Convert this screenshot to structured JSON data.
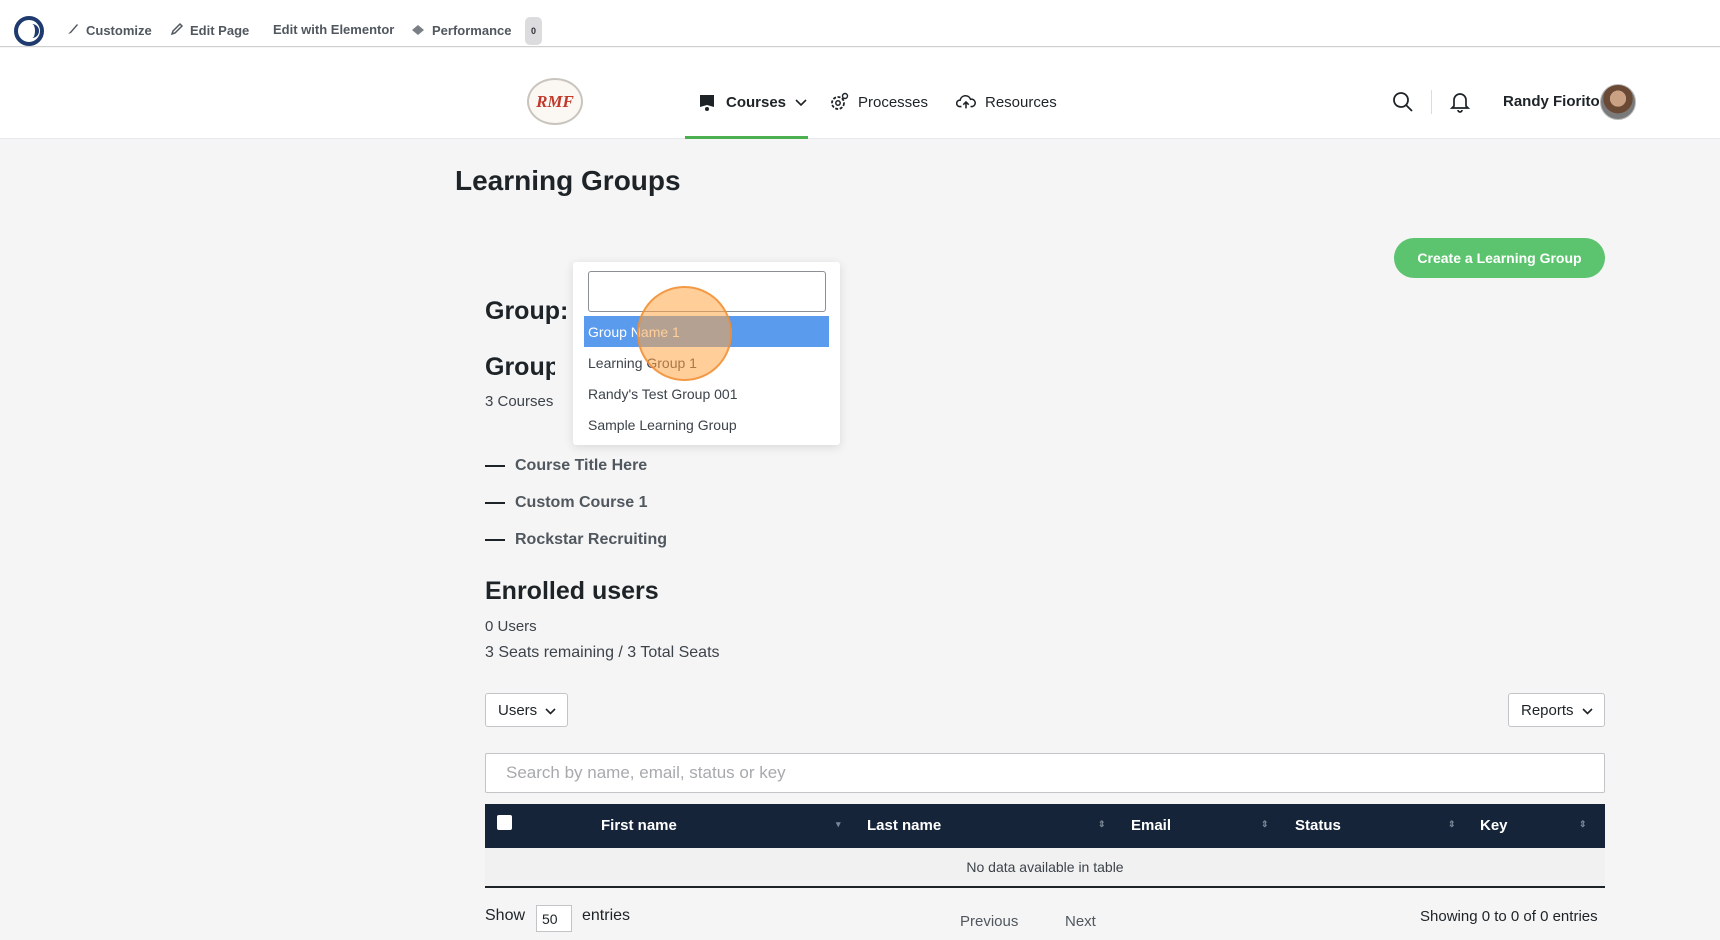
{
  "adminbar": {
    "items": [
      {
        "label": "Customize",
        "icon": "brush-icon"
      },
      {
        "label": "Edit Page",
        "icon": "pencil-icon"
      },
      {
        "label": "Edit with Elementor",
        "icon": ""
      },
      {
        "label": "Performance",
        "icon": "performance-icon"
      }
    ],
    "badge": "0"
  },
  "header": {
    "logo_text": "RMF",
    "nav": [
      {
        "label": "Courses",
        "icon": "courses-icon",
        "active": true
      },
      {
        "label": "Processes",
        "icon": "gear-icon"
      },
      {
        "label": "Resources",
        "icon": "cloud-icon"
      }
    ],
    "user_name": "Randy Fiorito",
    "accent_color": "#4caf50"
  },
  "page": {
    "title": "Learning Groups",
    "create_button": "Create a Learning Group",
    "group_label": "Group:",
    "group_courses_heading": "Group Courses",
    "courses_count": "3 Courses",
    "courses": [
      "Course Title Here",
      "Custom Course 1",
      "Rockstar Recruiting"
    ],
    "enrolled_heading": "Enrolled users",
    "users_count": "0 Users",
    "seats": "3 Seats remaining / 3 Total Seats",
    "users_dropdown": "Users",
    "reports_dropdown": "Reports",
    "search_placeholder": "Search by name, email, status or key"
  },
  "table": {
    "columns": [
      "First name",
      "Last name",
      "Email",
      "Status",
      "Key"
    ],
    "empty_message": "No data available in table",
    "header_color": "#16243a"
  },
  "footer": {
    "show_label": "Show",
    "entries_value": "50",
    "entries_label": "entries",
    "previous": "Previous",
    "next": "Next",
    "showing": "Showing 0 to 0 of 0 entries"
  },
  "group_dropdown": {
    "search_value": "",
    "options": [
      "Group Name 1",
      "Learning Group 1",
      "Randy's Test Group 001",
      "Sample Learning Group"
    ],
    "selected_index": 0,
    "highlight_color": "#5b9bed"
  }
}
